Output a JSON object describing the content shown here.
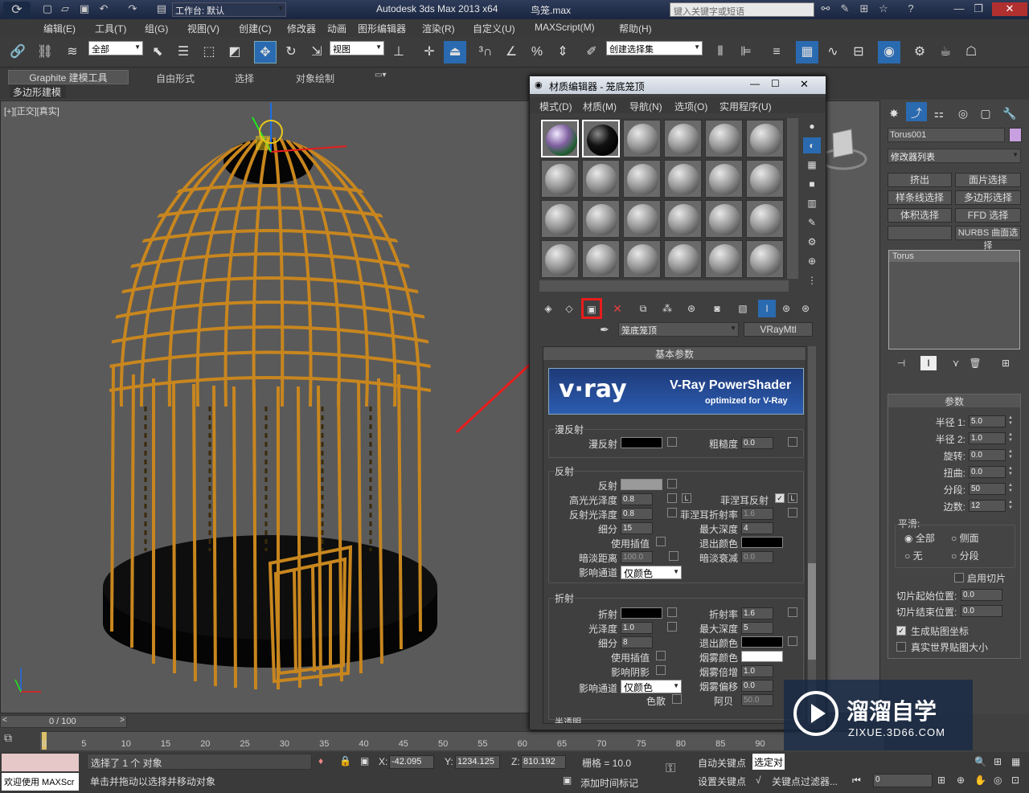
{
  "title": {
    "app": "Autodesk 3ds Max  2013 x64",
    "file": "鸟笼.max",
    "workspace": "工作台: 默认",
    "search_placeholder": "键入关键字或短语"
  },
  "menu": [
    "编辑(E)",
    "工具(T)",
    "组(G)",
    "视图(V)",
    "创建(C)",
    "修改器",
    "动画",
    "图形编辑器",
    "渲染(R)",
    "自定义(U)",
    "MAXScript(M)",
    "帮助(H)"
  ],
  "toolbar": {
    "filter": "全部",
    "coord": "视图",
    "selection_set": "创建选择集"
  },
  "ribbon": {
    "tabs": [
      "Graphite 建模工具",
      "自由形式",
      "选择",
      "对象绘制"
    ],
    "panel": "多边形建模"
  },
  "viewport": {
    "label": "[+][正交][真实]"
  },
  "material_editor": {
    "title": "材质编辑器 - 笼底笼顶",
    "menu": [
      "模式(D)",
      "材质(M)",
      "导航(N)",
      "选项(O)",
      "实用程序(U)"
    ],
    "material_name": "笼底笼顶",
    "material_type": "VRayMtl",
    "rollout": "基本参数",
    "banner": {
      "brand": "v·ray",
      "title": "V-Ray PowerShader",
      "sub": "optimized for V-Ray"
    },
    "diffuse": {
      "group": "漫反射",
      "label": "漫反射",
      "roughness_label": "粗糙度",
      "roughness": "0.0"
    },
    "reflection": {
      "group": "反射",
      "reflect": "反射",
      "hilight_label": "高光光泽度",
      "hilight": "0.8",
      "fresnel_label": "菲涅耳反射",
      "fresnel_ior_label": "菲涅耳折射率",
      "fresnel_ior": "1.6",
      "gloss_label": "反射光泽度",
      "gloss": "0.8",
      "subdivs_label": "细分",
      "subdivs": "15",
      "maxdepth_label": "最大深度",
      "maxdepth": "4",
      "interp_label": "使用插值",
      "exit_label": "退出颜色",
      "dimdist_label": "暗淡距离",
      "dimdist": "100.0",
      "dimfall_label": "暗淡衰减",
      "dimfall": "0.0",
      "affect_label": "影响通道",
      "affect": "仅颜色"
    },
    "refraction": {
      "group": "折射",
      "refract": "折射",
      "ior_label": "折射率",
      "ior": "1.6",
      "gloss_label": "光泽度",
      "gloss": "1.0",
      "maxdepth_label": "最大深度",
      "maxdepth": "5",
      "subdivs_label": "细分",
      "subdivs": "8",
      "exit_label": "退出颜色",
      "interp_label": "使用插值",
      "fog_label": "烟雾颜色",
      "shadows_label": "影响阴影",
      "fogmult_label": "烟雾倍增",
      "fogmult": "1.0",
      "affect_label": "影响通道",
      "affect": "仅颜色",
      "fogbias_label": "烟雾偏移",
      "fogbias": "0.0",
      "disp_label": "色散",
      "abbe_label": "阿贝",
      "abbe": "50.0"
    },
    "translucency": "半透明"
  },
  "command_panel": {
    "object_name": "Torus001",
    "modifier_list": "修改器列表",
    "buttons": [
      "挤出",
      "面片选择",
      "样条线选择",
      "多边形选择",
      "体积选择",
      "FFD 选择",
      "",
      "NURBS 曲面选择"
    ],
    "stack_item": "Torus",
    "rollout": "参数",
    "params": [
      {
        "label": "半径 1:",
        "value": "5.0"
      },
      {
        "label": "半径 2:",
        "value": "1.0"
      },
      {
        "label": "旋转:",
        "value": "0.0"
      },
      {
        "label": "扭曲:",
        "value": "0.0"
      },
      {
        "label": "分段:",
        "value": "50"
      },
      {
        "label": "边数:",
        "value": "12"
      }
    ],
    "smooth": {
      "label": "平滑:",
      "all": "全部",
      "sides": "侧面",
      "none": "无",
      "segments": "分段"
    },
    "slice_on": "启用切片",
    "slice_from_label": "切片起始位置:",
    "slice_from": "0.0",
    "slice_to_label": "切片结束位置:",
    "slice_to": "0.0",
    "gen_map": "生成贴图坐标",
    "real_world": "真实世界贴图大小"
  },
  "timeline": {
    "frame": "0 / 100",
    "ticks": [
      "0",
      "5",
      "10",
      "15",
      "20",
      "25",
      "30",
      "35",
      "40",
      "45",
      "50",
      "55",
      "60",
      "65",
      "70",
      "75",
      "80",
      "85",
      "90"
    ]
  },
  "status": {
    "selected": "选择了 1 个 对象",
    "prompt": "单击并拖动以选择并移动对象",
    "welcome": "欢迎使用 MAXScr",
    "x": "-42.095",
    "y": "1234.125",
    "z": "810.192",
    "grid": "栅格 = 10.0",
    "auto_key": "自动关键点",
    "set_key": "设置关键点",
    "selected_obj": "选定对",
    "add_time_tag": "添加时间标记",
    "key_filters": "关键点过滤器...",
    "frame_field": "0"
  },
  "watermark": {
    "brand": "溜溜自学",
    "url": "ZIXUE.3D66.COM"
  },
  "colors": {
    "cage": "#c8861e",
    "arrow": "#e81c1c",
    "highlight_box": "#e81c1c",
    "accent_blue": "#2a6ab0"
  }
}
